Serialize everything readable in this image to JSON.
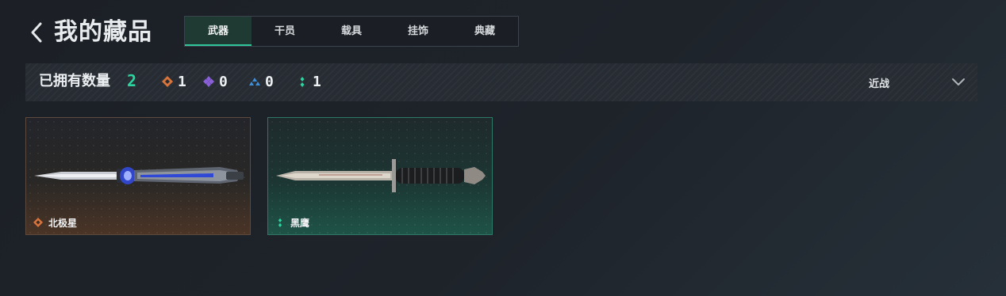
{
  "header": {
    "back_icon": "chevron-left-icon",
    "title": "我的藏品"
  },
  "tabs": [
    {
      "label": "武器",
      "active": true
    },
    {
      "label": "干员",
      "active": false
    },
    {
      "label": "载具",
      "active": false
    },
    {
      "label": "挂饰",
      "active": false
    },
    {
      "label": "典藏",
      "active": false
    }
  ],
  "summary": {
    "owned_label": "已拥有数量",
    "owned_count": "2",
    "rarity_counts": [
      {
        "icon": "orange-diamond-icon",
        "color": "#d9743a",
        "count": "1"
      },
      {
        "icon": "purple-diamond-icon",
        "color": "#8b5fd9",
        "count": "0"
      },
      {
        "icon": "blue-triangle-icon",
        "color": "#3e8fd8",
        "count": "0"
      },
      {
        "icon": "green-dots-icon",
        "color": "#2bd59f",
        "count": "1"
      }
    ],
    "filter": {
      "selected": "近战",
      "icon": "chevron-down-icon"
    }
  },
  "items": [
    {
      "name": "北极星",
      "rarity_icon": "orange-diamond-icon",
      "rarity_color": "#d9743a"
    },
    {
      "name": "黑鹰",
      "rarity_icon": "green-dots-icon",
      "rarity_color": "#2bd59f"
    }
  ],
  "colors": {
    "accent": "#2fc79a",
    "background": "#1e232a"
  }
}
